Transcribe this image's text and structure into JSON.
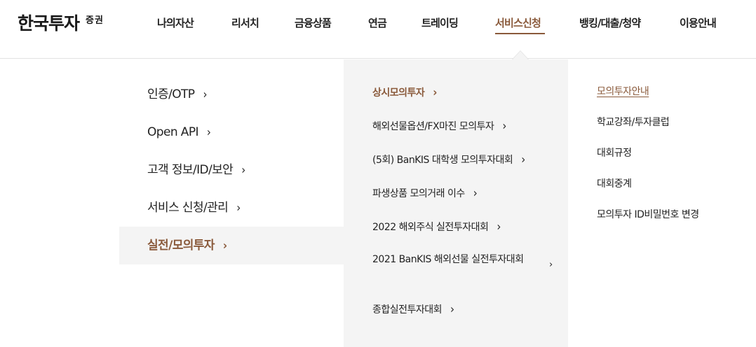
{
  "logo": {
    "main": "한국투자",
    "sub": "증권"
  },
  "gnb": [
    {
      "label": "나의자산"
    },
    {
      "label": "리서치"
    },
    {
      "label": "금융상품"
    },
    {
      "label": "연금"
    },
    {
      "label": "트레이딩"
    },
    {
      "label": "서비스신청",
      "active": true
    },
    {
      "label": "뱅킹/대출/청약"
    },
    {
      "label": "이용안내"
    }
  ],
  "menu_level1": [
    {
      "label": "인증/OTP"
    },
    {
      "label": "Open API"
    },
    {
      "label": "고객 정보/ID/보안"
    },
    {
      "label": "서비스 신청/관리"
    },
    {
      "label": "실전/모의투자",
      "active": true
    }
  ],
  "menu_level2": [
    {
      "label": "상시모의투자",
      "active": true
    },
    {
      "label": "해외선물옵션/FX마진 모의투자"
    },
    {
      "label": "(5회) BanKIS 대학생 모의투자대회"
    },
    {
      "label": "파생상품 모의거래 이수"
    },
    {
      "label": "2022 해외주식 실전투자대회"
    },
    {
      "label": "2021 BanKIS 해외선물 실전투자대회"
    },
    {
      "label": "종합실전투자대회"
    }
  ],
  "menu_level3": [
    {
      "label": "모의투자안내",
      "active": true
    },
    {
      "label": "학교강좌/투자클럽"
    },
    {
      "label": "대회규정"
    },
    {
      "label": "대회중계"
    },
    {
      "label": "모의투자 ID비밀번호 변경"
    }
  ],
  "chevron": "›",
  "colors": {
    "accent": "#8a5a3b",
    "panel": "#f4f4f4",
    "divider": "#e2e2e2"
  }
}
